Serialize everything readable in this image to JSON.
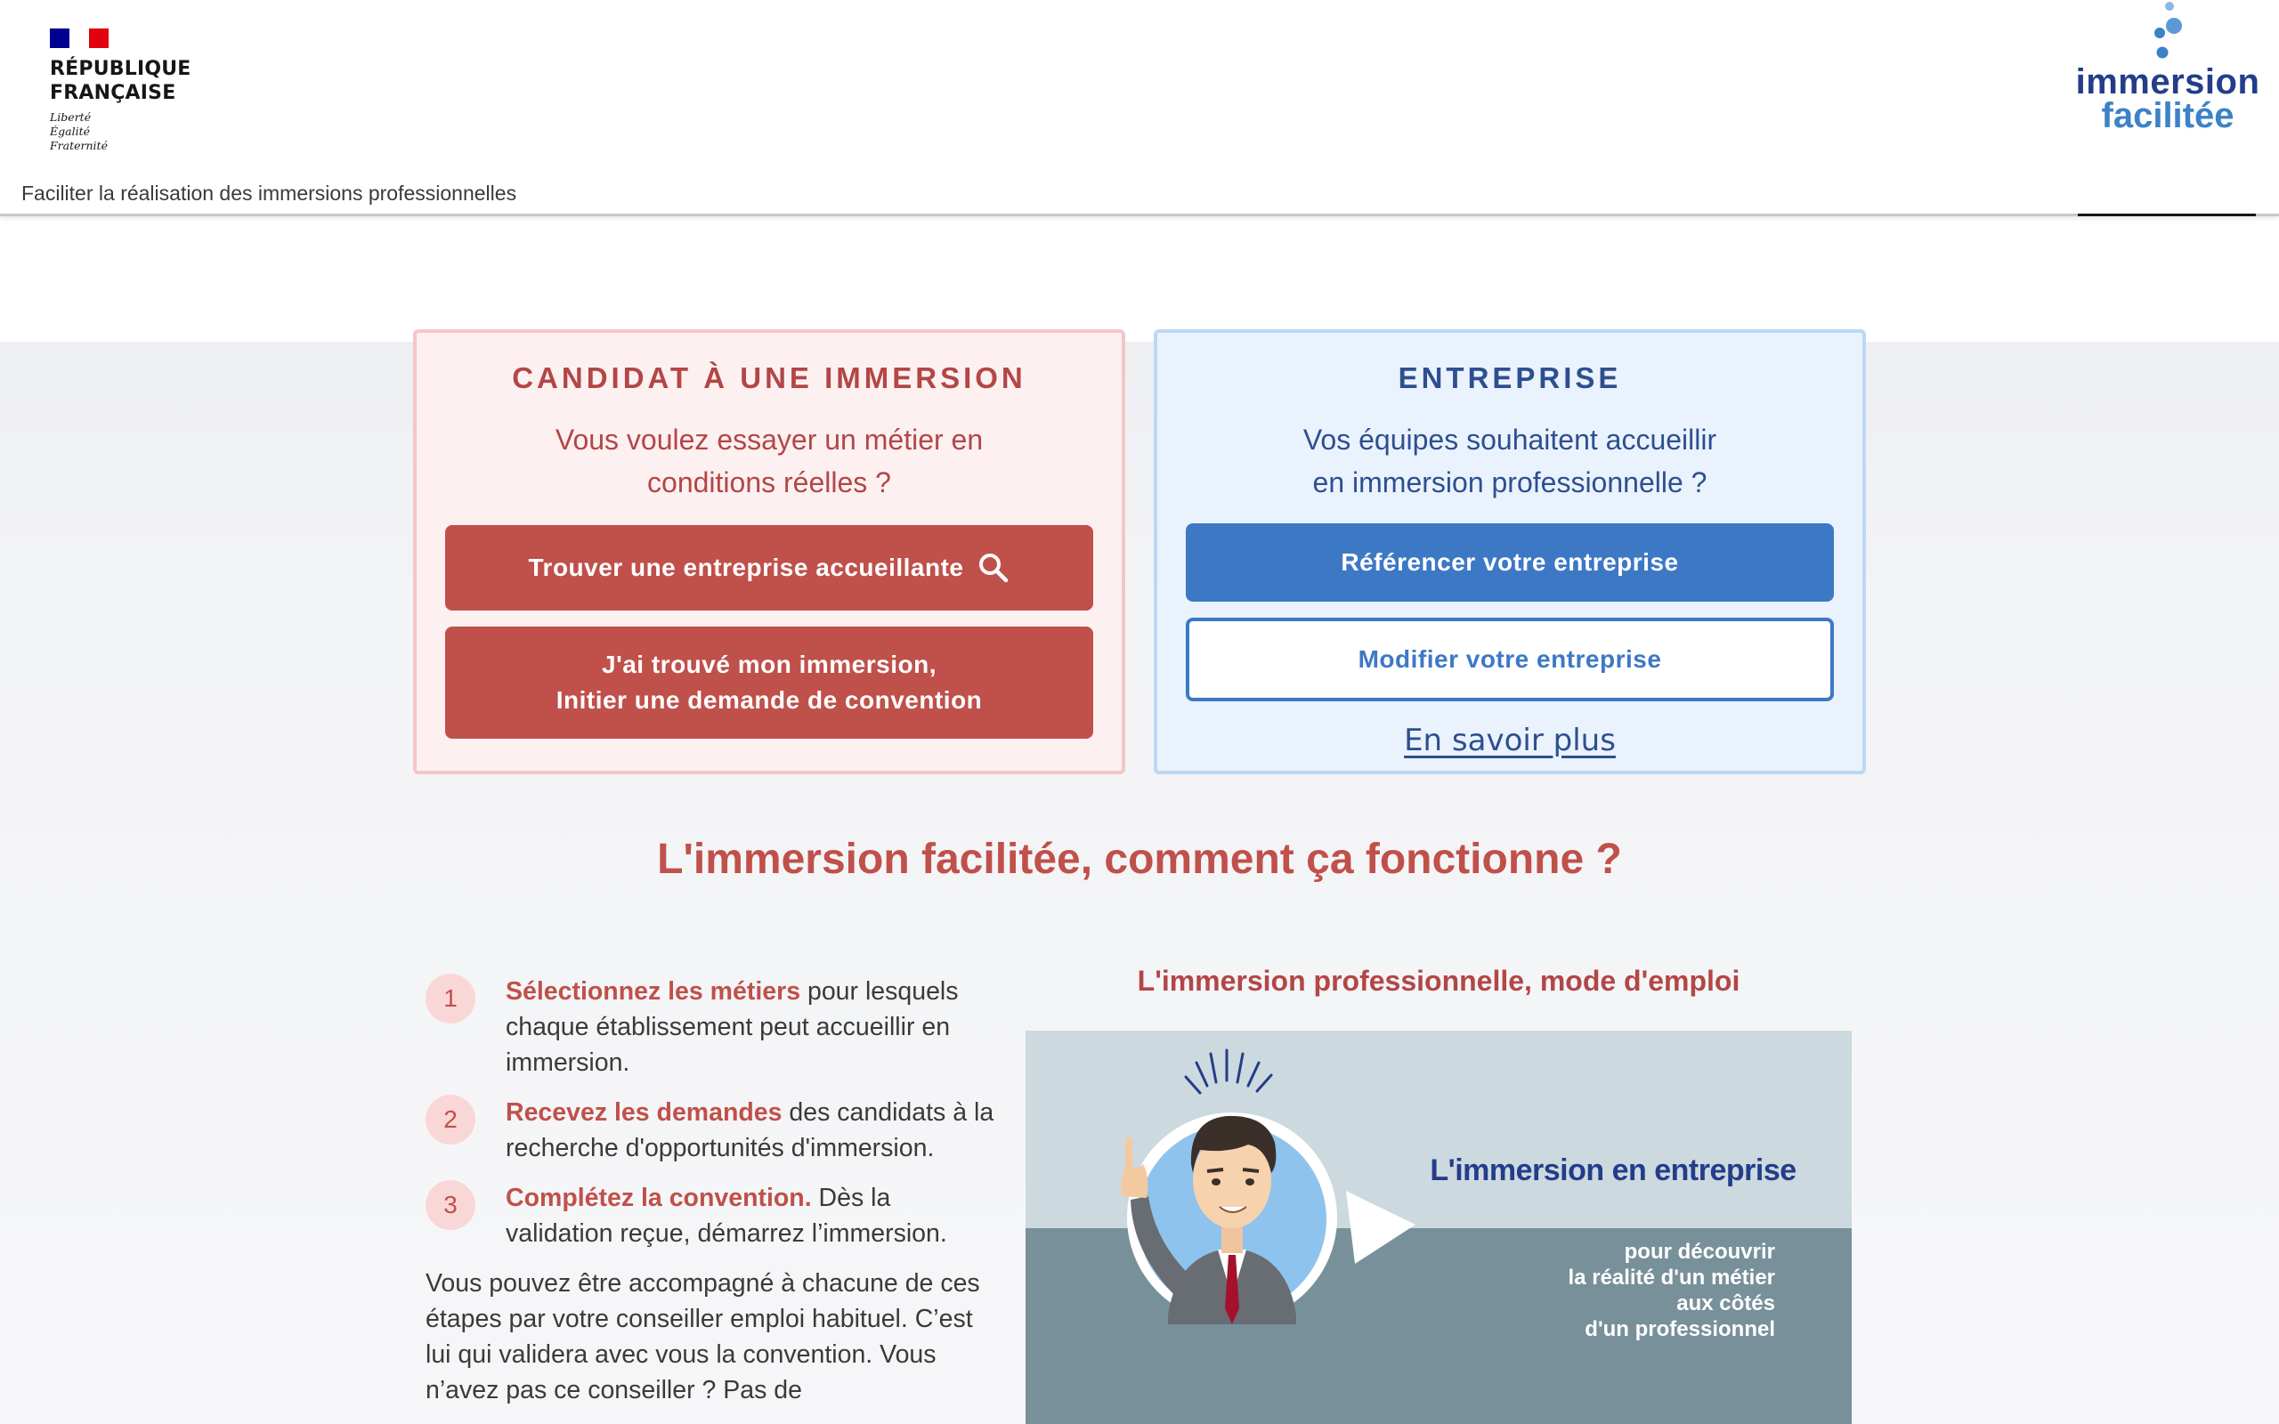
{
  "header": {
    "republic_line1": "RÉPUBLIQUE",
    "republic_line2": "FRANÇAISE",
    "motto_1": "Liberté",
    "motto_2": "Égalité",
    "motto_3": "Fraternité",
    "tagline": "Faciliter la réalisation des immersions professionnelles",
    "logo_word1": "immersion",
    "logo_word2": "facilitée"
  },
  "candidate_card": {
    "title": "CANDIDAT À UNE IMMERSION",
    "text_line1": "Vous voulez essayer un métier en",
    "text_line2": "conditions réelles ?",
    "find_button": "Trouver une entreprise accueillante",
    "convention_line1": "J'ai trouvé mon immersion,",
    "convention_line2": "Initier une demande de convention"
  },
  "enterprise_card": {
    "title": "ENTREPRISE",
    "text_line1": "Vos équipes souhaitent accueillir",
    "text_line2": "en immersion professionnelle ?",
    "register_button": "Référencer votre entreprise",
    "edit_button": "Modifier votre entreprise",
    "learn_more": "En savoir plus"
  },
  "how_it_works": {
    "title": "L'immersion facilitée, comment ça fonctionne ?",
    "steps": [
      {
        "num": "1",
        "strong": "Sélectionnez les métiers",
        "rest": " pour lesquels chaque établissement peut accueillir en immersion."
      },
      {
        "num": "2",
        "strong": "Recevez les demandes",
        "rest": " des candidats à la recherche d'opportunités d'immersion."
      },
      {
        "num": "3",
        "strong": "Complétez la convention.",
        "rest": " Dès la validation reçue, démarrez l’immersion."
      }
    ],
    "paragraph": "Vous pouvez être accompagné à chacune de ces étapes par votre conseiller emploi habituel. C’est lui qui validera avec vous la convention. Vous n’avez pas ce conseiller ? Pas de"
  },
  "video": {
    "title": "L'immersion professionnelle, mode d'emploi",
    "heading": "L'immersion en entreprise",
    "sub_line1": "pour découvrir",
    "sub_line2": "la réalité d'un métier",
    "sub_line3": "aux côtés",
    "sub_line4": "d'un professionnel"
  },
  "colors": {
    "candidate_accent": "#c0504a",
    "enterprise_accent": "#3d78c5",
    "brand_navy": "#233d8a"
  },
  "icons": {
    "search": "search-icon",
    "marianne_flag": "flag-icon"
  }
}
